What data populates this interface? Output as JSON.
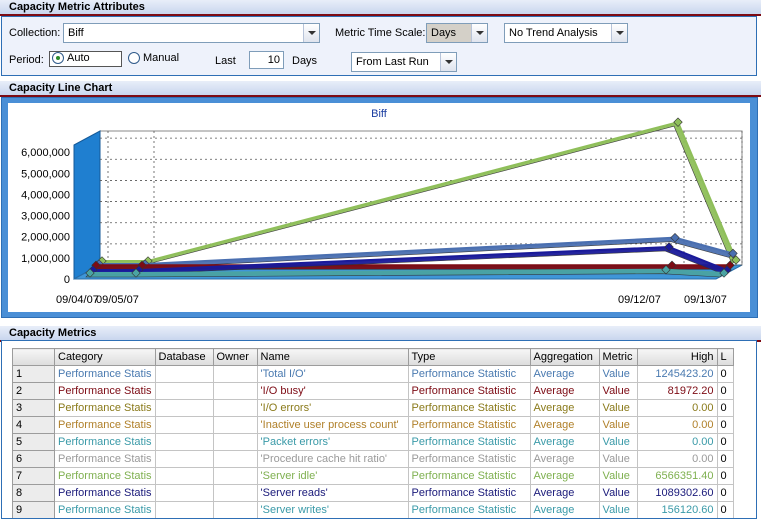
{
  "attributes": {
    "header": "Capacity Metric Attributes",
    "collection_label": "Collection:",
    "collection_value": "Biff",
    "time_scale_label": "Metric Time Scale:",
    "time_scale_value": "Days",
    "trend_value": "No Trend Analysis",
    "period_label": "Period:",
    "auto_label": "Auto",
    "manual_label": "Manual",
    "last_label": "Last",
    "last_value": "10",
    "days_label": "Days",
    "from_value": "From Last Run"
  },
  "chart_section": {
    "header": "Capacity Line Chart"
  },
  "chart_data": {
    "type": "line",
    "title": "Biff",
    "x": [
      "09/04/07",
      "09/05/07",
      "09/12/07",
      "09/13/07"
    ],
    "yticks": [
      "0",
      "1,000,000",
      "2,000,000",
      "3,000,000",
      "4,000,000",
      "5,000,000",
      "6,000,000"
    ],
    "ylim": [
      0,
      7000000
    ],
    "series": [
      {
        "color": "#8fbf5a",
        "values": [
          0,
          0,
          6566351.4,
          50000
        ]
      },
      {
        "color": "#4a6fb0",
        "values": [
          0,
          0,
          1245423.2,
          500000
        ]
      },
      {
        "color": "#7d0b14",
        "values": [
          81972.2,
          81972.2,
          81972.2,
          81972.2
        ]
      },
      {
        "color": "#1a1a99",
        "values": [
          0,
          0,
          1089302.6,
          0
        ]
      },
      {
        "color": "#4aa3a3",
        "values": [
          0,
          0,
          156120.6,
          0
        ]
      }
    ],
    "grid": true,
    "legend": "none"
  },
  "metrics": {
    "header": "Capacity Metrics",
    "columns": [
      "",
      "Category",
      "Database",
      "Owner",
      "Name",
      "Type",
      "Aggregation",
      "Metric",
      "High",
      "L"
    ],
    "rows": [
      {
        "n": "1",
        "category": "Performance Statis",
        "database": "",
        "owner": "",
        "name": "'Total I/O'",
        "type": "Performance Statistic",
        "aggregation": "Average",
        "metric": "Value",
        "high": "1245423.20",
        "l": "0",
        "color": "#4a7ab0"
      },
      {
        "n": "2",
        "category": "Performance Statis",
        "database": "",
        "owner": "",
        "name": "'I/O busy'",
        "type": "Performance Statistic",
        "aggregation": "Average",
        "metric": "Value",
        "high": "81972.20",
        "l": "0",
        "color": "#7d0b14"
      },
      {
        "n": "3",
        "category": "Performance Statis",
        "database": "",
        "owner": "",
        "name": "'I/O errors'",
        "type": "Performance Statistic",
        "aggregation": "Average",
        "metric": "Value",
        "high": "0.00",
        "l": "0",
        "color": "#8a7a1a"
      },
      {
        "n": "4",
        "category": "Performance Statis",
        "database": "",
        "owner": "",
        "name": "'Inactive user process count'",
        "type": "Performance Statistic",
        "aggregation": "Average",
        "metric": "Value",
        "high": "0.00",
        "l": "0",
        "color": "#b0802a"
      },
      {
        "n": "5",
        "category": "Performance Statis",
        "database": "",
        "owner": "",
        "name": "'Packet errors'",
        "type": "Performance Statistic",
        "aggregation": "Average",
        "metric": "Value",
        "high": "0.00",
        "l": "0",
        "color": "#3a9aa8"
      },
      {
        "n": "6",
        "category": "Performance Statis",
        "database": "",
        "owner": "",
        "name": "'Procedure cache hit ratio'",
        "type": "Performance Statistic",
        "aggregation": "Average",
        "metric": "Value",
        "high": "0.00",
        "l": "0",
        "color": "#9a9a9a"
      },
      {
        "n": "7",
        "category": "Performance Statis",
        "database": "",
        "owner": "",
        "name": "'Server idle'",
        "type": "Performance Statistic",
        "aggregation": "Average",
        "metric": "Value",
        "high": "6566351.40",
        "l": "0",
        "color": "#7fb050"
      },
      {
        "n": "8",
        "category": "Performance Statis",
        "database": "",
        "owner": "",
        "name": "'Server reads'",
        "type": "Performance Statistic",
        "aggregation": "Average",
        "metric": "Value",
        "high": "1089302.60",
        "l": "0",
        "color": "#1a1a7a"
      },
      {
        "n": "9",
        "category": "Performance Statis",
        "database": "",
        "owner": "",
        "name": "'Server writes'",
        "type": "Performance Statistic",
        "aggregation": "Average",
        "metric": "Value",
        "high": "156120.60",
        "l": "0",
        "color": "#3a9aa8"
      }
    ]
  }
}
